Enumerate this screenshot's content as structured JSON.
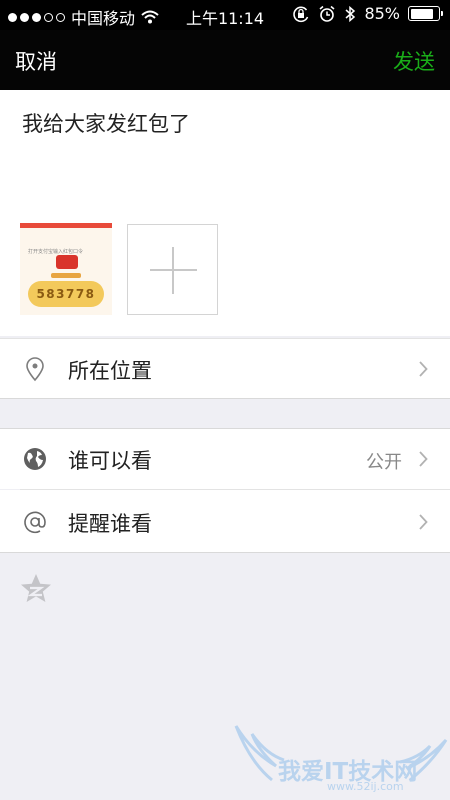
{
  "status_bar": {
    "carrier": "中国移动",
    "time": "上午11:14",
    "battery_text": "85%",
    "battery_level": 0.85
  },
  "nav": {
    "cancel_label": "取消",
    "send_label": "发送"
  },
  "composer": {
    "text": "我给大家发红包了",
    "thumbnail": {
      "code": "583778",
      "tip": "打开支付宝输入红包口令"
    }
  },
  "rows": {
    "location": {
      "label": "所在位置",
      "icon": "location-pin-icon"
    },
    "visibility": {
      "label": "谁可以看",
      "value": "公开",
      "icon": "globe-icon"
    },
    "mention": {
      "label": "提醒谁看",
      "icon": "at-icon"
    }
  },
  "share": {
    "icon": "qzone-icon"
  },
  "watermark": {
    "text": "我爱IT技术网",
    "url": "www.52ij.com"
  },
  "colors": {
    "nav_bg": "#050505",
    "send": "#1aad19",
    "page_bg": "#efeff4"
  }
}
